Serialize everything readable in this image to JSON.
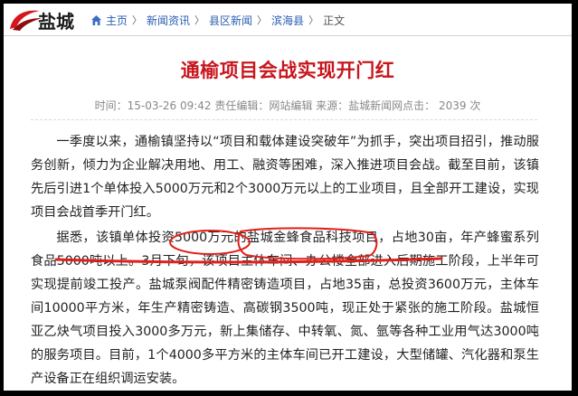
{
  "header": {
    "site_logo": "盐城",
    "breadcrumbs": [
      {
        "label": "主页"
      },
      {
        "label": "新闻资讯"
      },
      {
        "label": "县区新闻"
      },
      {
        "label": "滨海县"
      },
      {
        "label": "正文"
      }
    ],
    "separator": "〉"
  },
  "article": {
    "title": "通榆项目会战实现开门红",
    "meta": "时间：15-03-26 09:42 责任编辑：网站编辑 来源：盐城新闻网点击： 2039 次",
    "paragraphs": [
      "一季度以来，通榆镇坚持以“项目和载体建设突破年”为抓手，突出项目招引，推动服务创新，倾力为企业解决用地、用工、融资等困难，深入推进项目会战。截至目前，该镇先后引进1个单体投入5000万元和2个3000万元以上的工业项目，且全部开工建设，实现项目会战首季开门红。",
      "据悉，该镇单体投资5000万元的盐城金蜂食品科技项目，占地30亩，年产蜂蜜系列食品5000吨以上。3月下旬，该项目主体车间、办公楼全部进入后期施工阶段，上半年可实现提前竣工投产。盐城泵阀配件精密铸造项目，占地35亩，总投资3600万元，主体车间10000平方米，年生产精密铸造、高碳钢3500吨，现正处于紧张的施工阶段。盐城恒亚乙炔气项目投入3000多万元，新上集储存、中转氧、氮、氩等各种工业用气达3000吨的服务项目。目前，1个4000多平方米的主体车间已开工建设，大型储罐、汽化器和泵生产设备正在组织调运安装。"
    ]
  },
  "colors": {
    "title_red": "#c8161d",
    "link_blue": "#2a5db0",
    "annotation_red": "#e0201a"
  },
  "icons": {
    "home": "home-icon",
    "logo_mark": "red-swoosh-logo-icon"
  }
}
